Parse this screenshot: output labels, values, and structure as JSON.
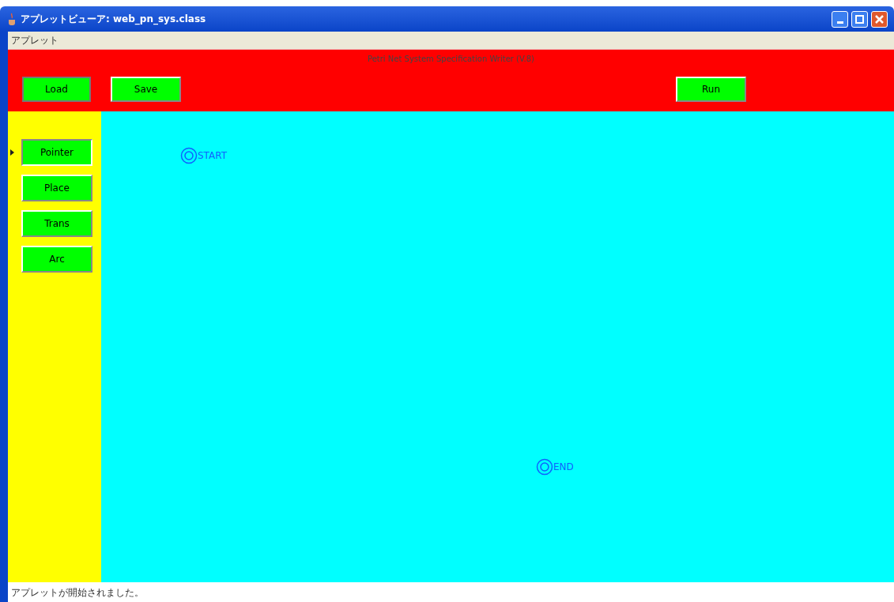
{
  "window": {
    "title": "アプレットビューア: web_pn_sys.class"
  },
  "menu": [
    "アプレット"
  ],
  "header": {
    "title": "Petri Net System Specification Writer (V.8)",
    "buttons": [
      "Load",
      "Save",
      "Run"
    ]
  },
  "tools": [
    {
      "label": "Pointer",
      "selected": true
    },
    {
      "label": "Place",
      "selected": false
    },
    {
      "label": "Trans",
      "selected": false
    },
    {
      "label": "Arc",
      "selected": false
    }
  ],
  "canvas": {
    "nodes": [
      {
        "label": "START"
      },
      {
        "label": "END"
      }
    ]
  },
  "status_bar": "アプレットが開始されました。"
}
